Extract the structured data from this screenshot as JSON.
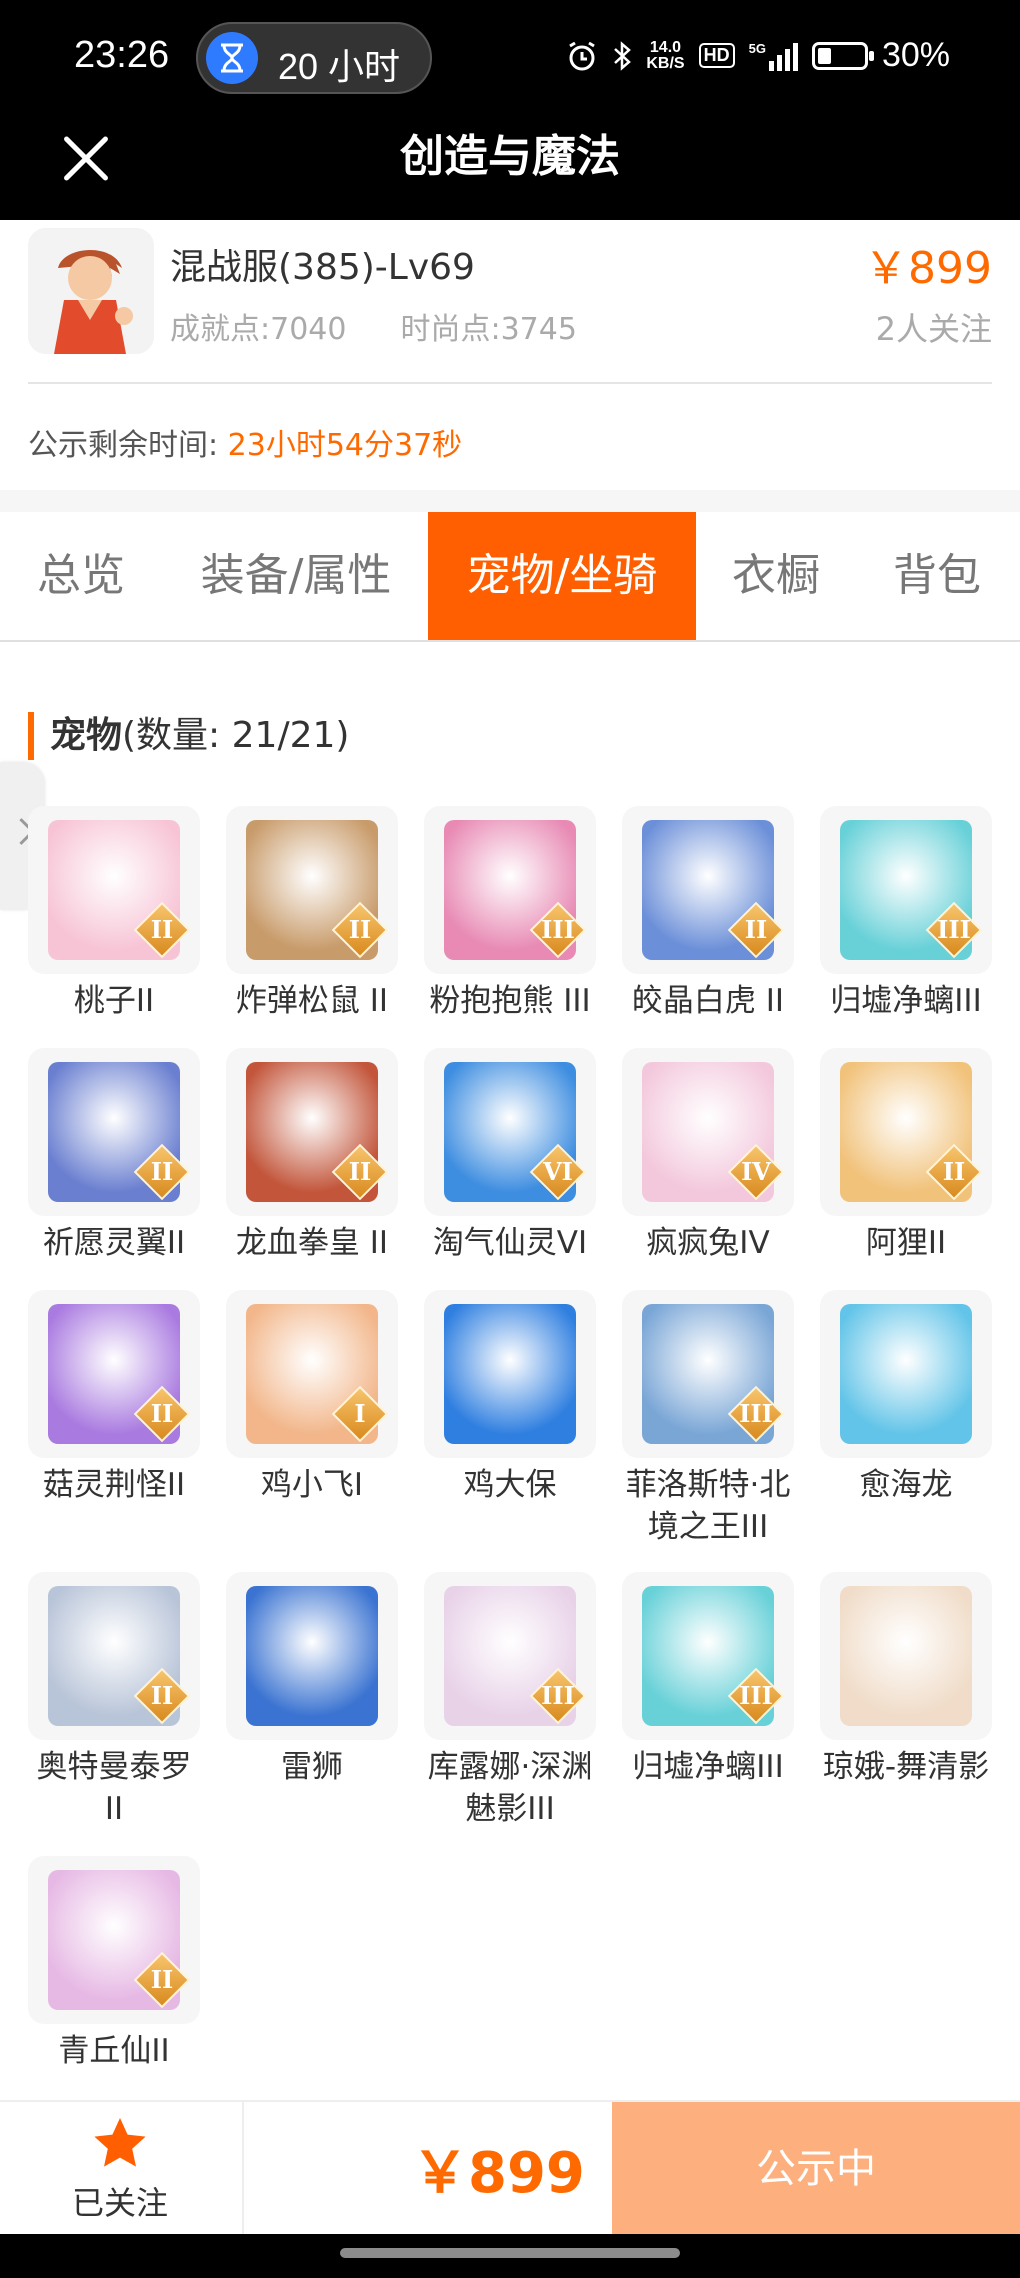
{
  "status_bar": {
    "time": "23:26",
    "timer_label": "20 小时",
    "network_speed_value": "14.0",
    "network_speed_unit": "KB/S",
    "hd_label": "HD",
    "signal_label": "5G",
    "battery_percent": "30%",
    "battery_level": 0.3,
    "icons": [
      "hourglass-icon",
      "alarm-icon",
      "bluetooth-icon",
      "hd-icon",
      "signal-icon",
      "battery-icon"
    ]
  },
  "header": {
    "title": "创造与魔法",
    "close_icon": "close-icon"
  },
  "account": {
    "name": "混战服(385)-Lv69",
    "achievement": "成就点:7040",
    "fashion": "时尚点:3745",
    "price": "￥899",
    "watchers": "2人关注"
  },
  "countdown": {
    "label": "公示剩余时间:",
    "value": "23小时54分37秒"
  },
  "tabs": [
    {
      "label": "总览",
      "active": false
    },
    {
      "label": "装备/属性",
      "active": false
    },
    {
      "label": "宠物/坐骑",
      "active": true
    },
    {
      "label": "衣橱",
      "active": false
    },
    {
      "label": "背包",
      "active": false
    }
  ],
  "pets_section": {
    "title": "宠物",
    "count": "(数量: 21/21)"
  },
  "pets": [
    {
      "name": "桃子II",
      "badge": "II",
      "color": "#f7c4d6"
    },
    {
      "name": "炸弹松鼠 II",
      "badge": "II",
      "color": "#c89b6a"
    },
    {
      "name": "粉抱抱熊 III",
      "badge": "III",
      "color": "#e88ab4"
    },
    {
      "name": "皎晶白虎 II",
      "badge": "II",
      "color": "#6b8fd8"
    },
    {
      "name": "归墟净螭III",
      "badge": "III",
      "color": "#68d1d8"
    },
    {
      "name": "祈愿灵翼II",
      "badge": "II",
      "color": "#6a7fd0"
    },
    {
      "name": "龙血拳皇 II",
      "badge": "II",
      "color": "#c2553a"
    },
    {
      "name": "淘气仙灵VI",
      "badge": "VI",
      "color": "#3d8de0"
    },
    {
      "name": "疯疯兔IV",
      "badge": "IV",
      "color": "#f3c8dc"
    },
    {
      "name": "阿狸II",
      "badge": "II",
      "color": "#f1c27a"
    },
    {
      "name": "菇灵荆怪II",
      "badge": "II",
      "color": "#a97ae0"
    },
    {
      "name": "鸡小飞I",
      "badge": "I",
      "color": "#f2b68a"
    },
    {
      "name": "鸡大保",
      "badge": "",
      "color": "#2f7fe0"
    },
    {
      "name": "菲洛斯特·北境之王III",
      "badge": "III",
      "color": "#7aa6d6"
    },
    {
      "name": "愈海龙",
      "badge": "",
      "color": "#62c4e8"
    },
    {
      "name": "奥特曼泰罗II",
      "badge": "II",
      "color": "#b8c4d8"
    },
    {
      "name": "雷狮",
      "badge": "",
      "color": "#3a73d1"
    },
    {
      "name": "库露娜·深渊魅影III",
      "badge": "III",
      "color": "#e8d2e8"
    },
    {
      "name": "归墟净螭III",
      "badge": "III",
      "color": "#68d1d8"
    },
    {
      "name": "琼娥-舞清影",
      "badge": "",
      "color": "#f0dcc8"
    },
    {
      "name": "青丘仙II",
      "badge": "II",
      "color": "#e6b8e4"
    }
  ],
  "bottom_bar": {
    "favorite_label": "已关注",
    "price": "￥899",
    "action_label": "公示中",
    "accent": "#ff6a00",
    "action_color": "#fdaf7e"
  }
}
